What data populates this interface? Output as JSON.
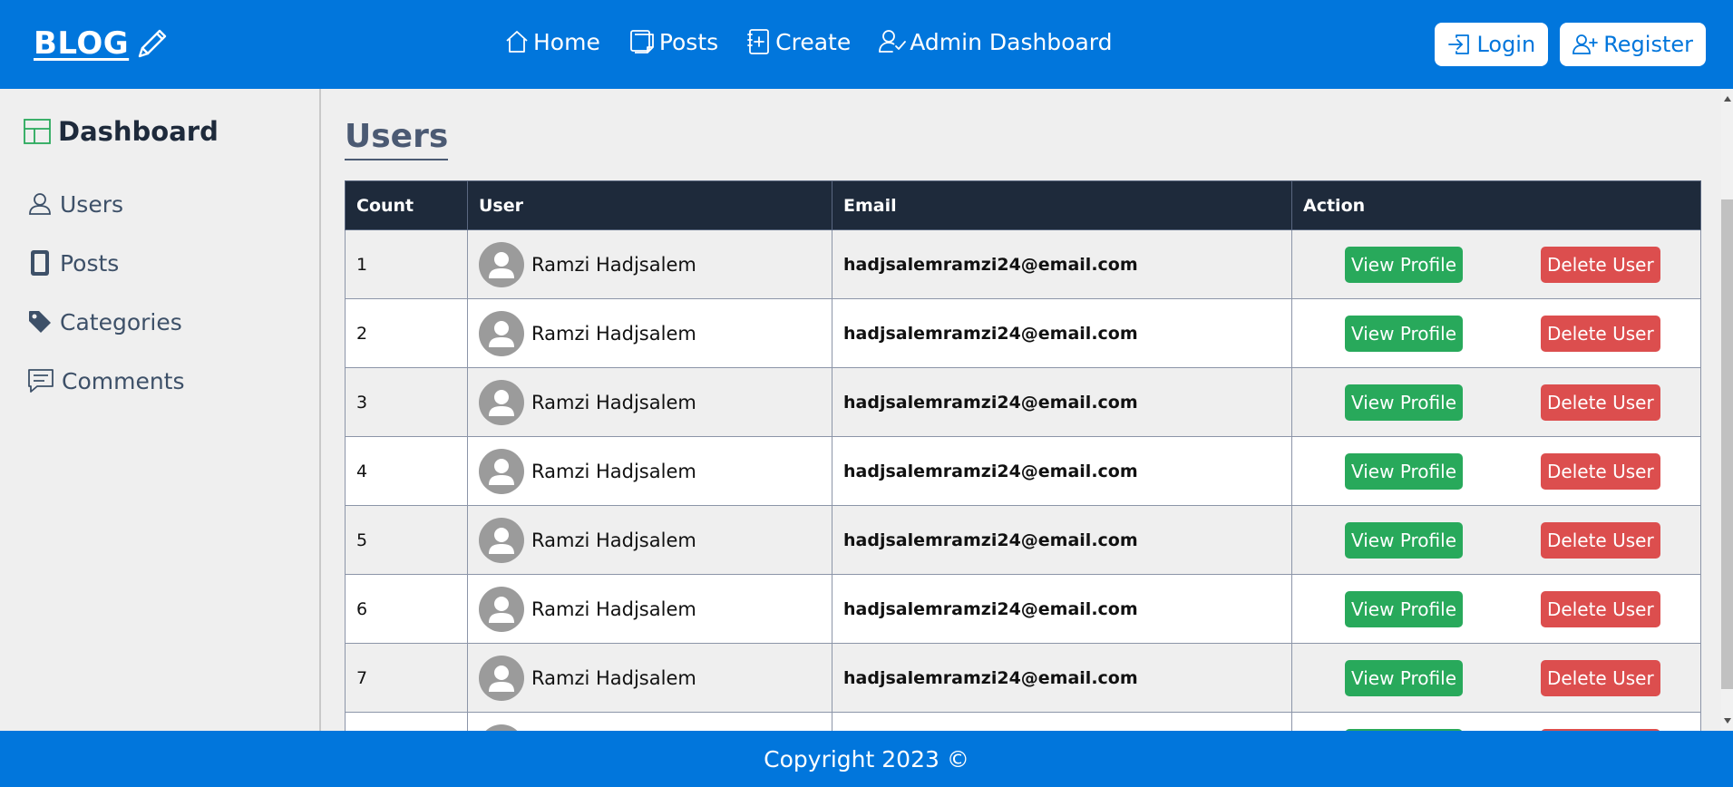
{
  "header": {
    "logo": "BLOG",
    "nav": [
      {
        "label": "Home",
        "icon": "home-icon"
      },
      {
        "label": "Posts",
        "icon": "posts-icon"
      },
      {
        "label": "Create",
        "icon": "create-icon"
      },
      {
        "label": "Admin Dashboard",
        "icon": "admin-icon"
      }
    ],
    "login_label": "Login",
    "register_label": "Register"
  },
  "sidebar": {
    "title": "Dashboard",
    "items": [
      {
        "label": "Users",
        "icon": "user-icon"
      },
      {
        "label": "Posts",
        "icon": "tablet-icon"
      },
      {
        "label": "Categories",
        "icon": "tag-icon"
      },
      {
        "label": "Comments",
        "icon": "comments-icon"
      }
    ]
  },
  "main": {
    "title": "Users",
    "columns": [
      "Count",
      "User",
      "Email",
      "Action"
    ],
    "view_label": "View Profile",
    "delete_label": "Delete User",
    "rows": [
      {
        "count": "1",
        "user": "Ramzi Hadjsalem",
        "email": "hadjsalemramzi24@email.com"
      },
      {
        "count": "2",
        "user": "Ramzi Hadjsalem",
        "email": "hadjsalemramzi24@email.com"
      },
      {
        "count": "3",
        "user": "Ramzi Hadjsalem",
        "email": "hadjsalemramzi24@email.com"
      },
      {
        "count": "4",
        "user": "Ramzi Hadjsalem",
        "email": "hadjsalemramzi24@email.com"
      },
      {
        "count": "5",
        "user": "Ramzi Hadjsalem",
        "email": "hadjsalemramzi24@email.com"
      },
      {
        "count": "6",
        "user": "Ramzi Hadjsalem",
        "email": "hadjsalemramzi24@email.com"
      },
      {
        "count": "7",
        "user": "Ramzi Hadjsalem",
        "email": "hadjsalemramzi24@email.com"
      },
      {
        "count": "",
        "user": "",
        "email": ""
      }
    ]
  },
  "footer": {
    "text": "Copyright 2023 ©"
  },
  "colors": {
    "primary": "#0176dc",
    "table_header": "#1e2a3b",
    "view_button": "#28a95b",
    "delete_button": "#dc4e4e"
  }
}
